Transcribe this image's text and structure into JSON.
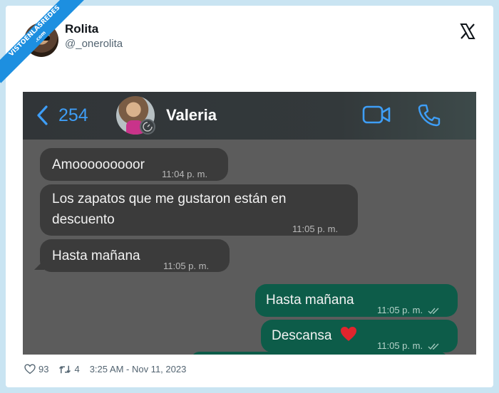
{
  "watermark": {
    "line1": "VISTOENLASREDES",
    "line2": ".com"
  },
  "tweet": {
    "author_name": "Rolita",
    "author_handle": "@_onerolita",
    "timestamp": "3:25 AM - Nov 11, 2023",
    "likes": "93",
    "retweets": "4"
  },
  "chat": {
    "back_count": "254",
    "contact_name": "Valeria",
    "messages": [
      {
        "direction": "in",
        "text": "Amooooooooor",
        "time": "11:04 p. m."
      },
      {
        "direction": "in",
        "text_line1": "Los zapatos que me gustaron están en",
        "text_line2": "descuento",
        "time": "11:05 p. m."
      },
      {
        "direction": "in",
        "text": "Hasta mañana",
        "time": "11:05 p. m."
      },
      {
        "direction": "out",
        "text": "Hasta mañana",
        "time": "11:05 p. m."
      },
      {
        "direction": "out",
        "text": "Descansa",
        "time": "11:05 p. m.",
        "emoji": "heart"
      }
    ],
    "colors": {
      "incoming_bubble": "#3b3b3b",
      "outgoing_bubble": "#0d5c49",
      "accent": "#3e9ef7",
      "background": "#5c5c5c"
    }
  },
  "icons": [
    "x-logo-icon",
    "chevron-left-icon",
    "video-call-icon",
    "phone-icon",
    "heart-icon",
    "retweet-icon",
    "double-check-icon",
    "timer-icon"
  ]
}
